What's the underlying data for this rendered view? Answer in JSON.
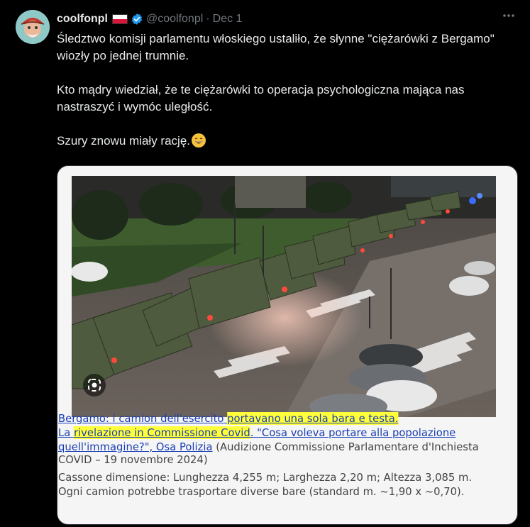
{
  "author": {
    "name": "coolfonpl",
    "handle": "@coolfonpl",
    "separator": "·",
    "date": "Dec 1"
  },
  "post": {
    "text": "Śledztwo komisji parlamentu włoskiego ustaliło, że słynne \"ciężarówki z Bergamo\" wiozły po jednej trumnie.\n\nKto mądry wiedział, że te ciężarówki to operacja psychologiczna mająca nas nastraszyć i wymóc uległość.\n\nSzury znowu miały rację."
  },
  "caption": {
    "line1_a": "Bergamo: i camion dell'esercito ",
    "line1_b": "portavano una sola bara e testa.",
    "line2_a": "La ",
    "line2_b": "rivelazione in Commissione Covid",
    "line2_c": ". \"Cosa voleva portare alla popolazione",
    "line3_a": "quell'immagine?\", Osa Polizia",
    "line3_b": " (Audizione Commissione Parlamentare d'Inchiesta",
    "line4": "COVID – 19 novembre 2024)",
    "line5": "Cassone dimensione: Lunghezza 4,255 m; Larghezza 2,20 m; Altezza 3,085 m.",
    "line6": "Ogni camion potrebbe trasportare diverse bare (standard m. ~1,90 x ~0,70)."
  },
  "icons": {
    "more": "more-icon",
    "verified": "verified-badge-icon",
    "lens": "google-lens-icon"
  },
  "colors": {
    "background": "#000000",
    "text": "#e7e9ea",
    "muted": "#71767b",
    "verified": "#1d9bf0",
    "link": "#1a3fb5",
    "highlight": "#ffff3a"
  }
}
